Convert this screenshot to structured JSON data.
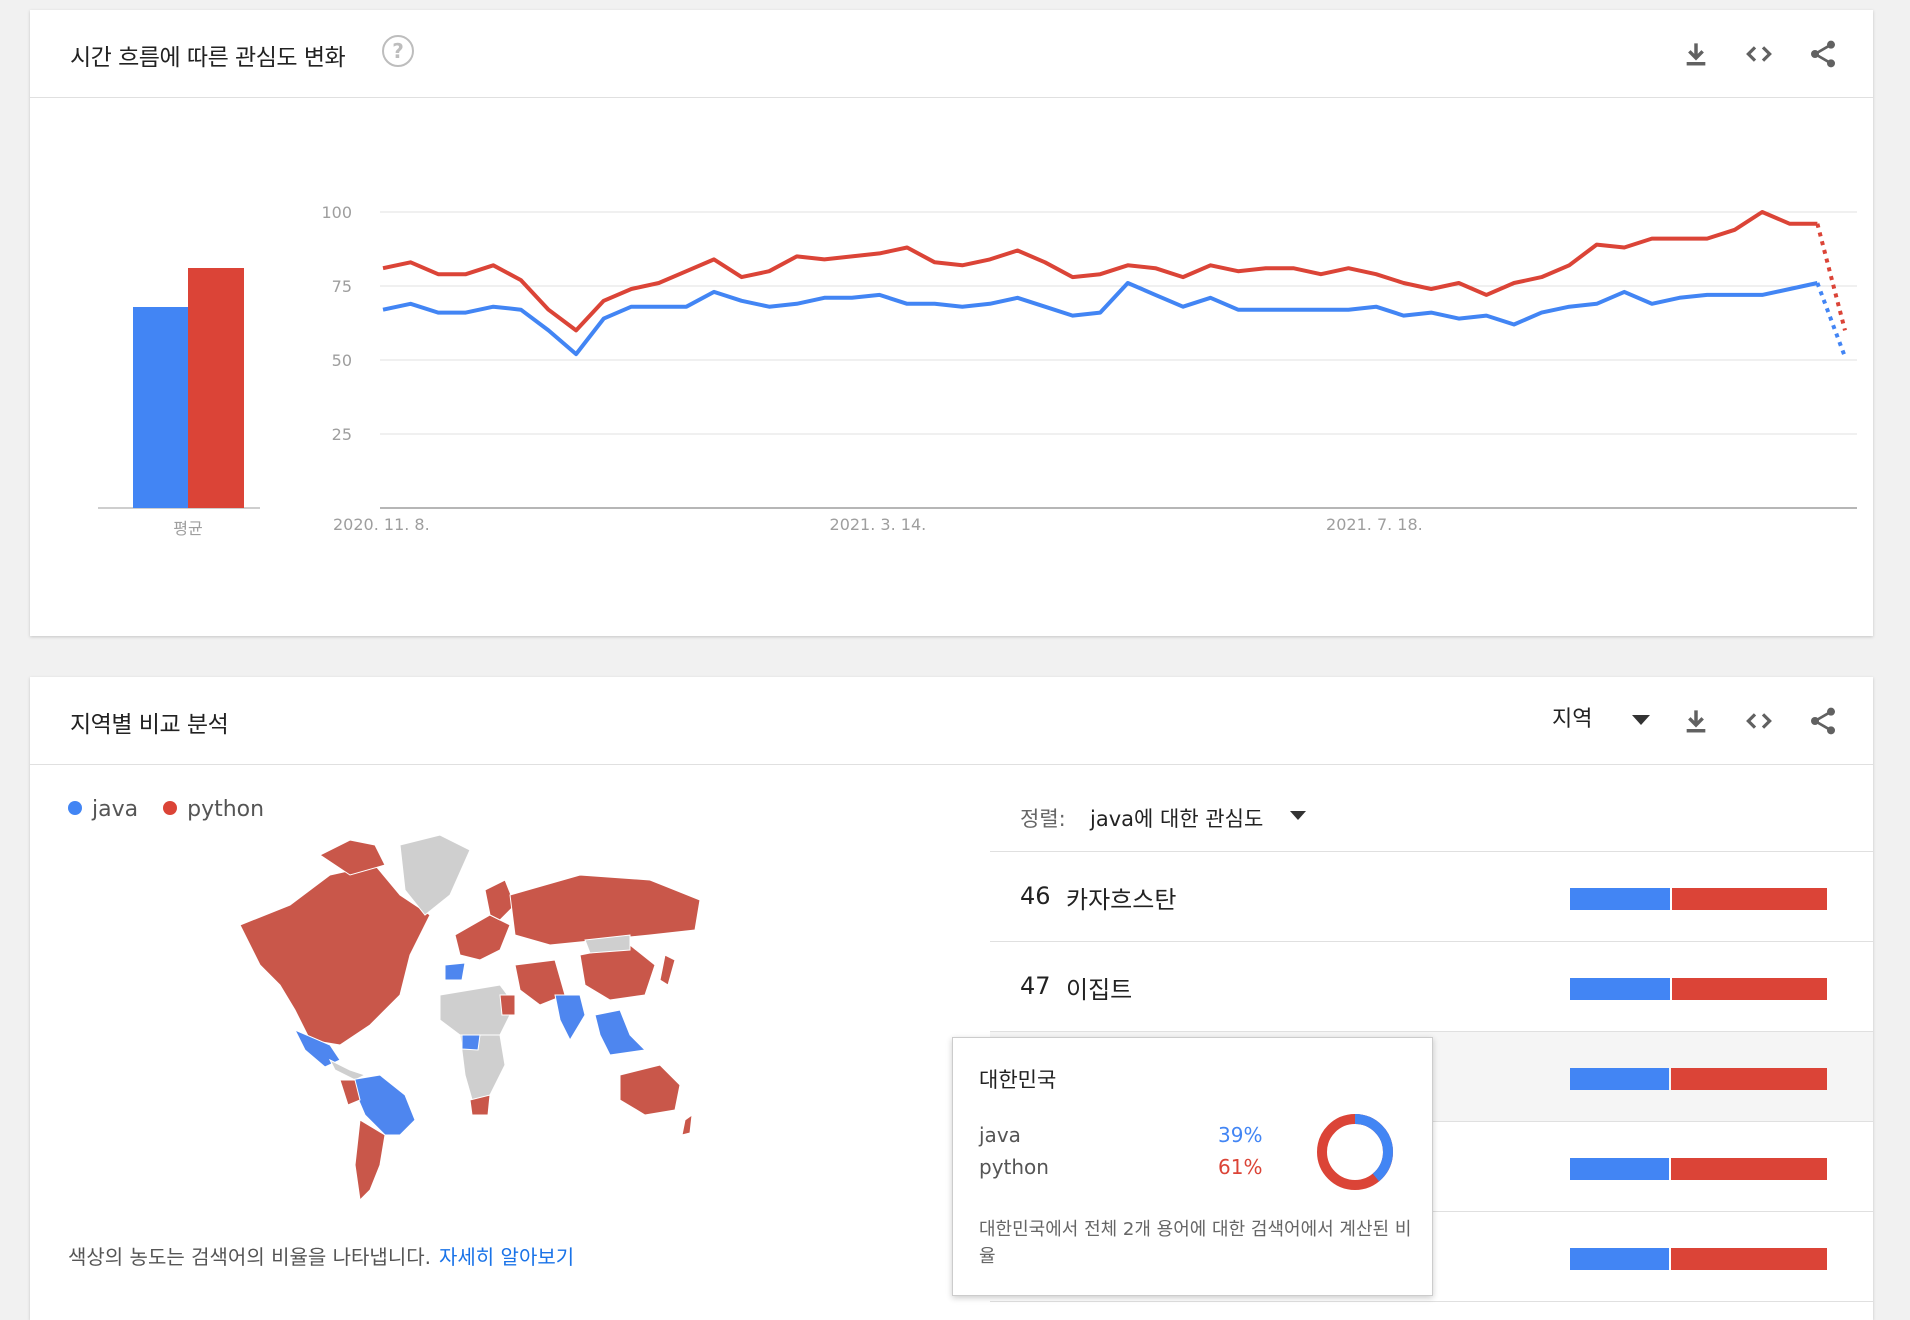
{
  "colors": {
    "java": "#4285f4",
    "python": "#db4437",
    "grid": "#e0e0e0",
    "axis_text": "#9e9e9e"
  },
  "section1": {
    "title": "시간 흐름에 따른 관심도 변화",
    "help_icon": "?",
    "avg_label": "평균"
  },
  "section2": {
    "title": "지역별 비교 분석",
    "region_select": "지역",
    "legend": [
      {
        "name": "java"
      },
      {
        "name": "python"
      }
    ],
    "footnote": "색상의 농도는 검색어의 비율을 나타냅니다.",
    "learn_more": "자세히 알아보기",
    "sort_label": "정렬:",
    "sort_value": "java에 대한 관심도",
    "rows": [
      {
        "rank": "46",
        "name": "카자흐스탄",
        "java": 0.39,
        "python": 0.61
      },
      {
        "rank": "47",
        "name": "이집트",
        "java": 0.39,
        "python": 0.61
      },
      {
        "rank": "",
        "name": "",
        "java": 0.385,
        "python": 0.615
      },
      {
        "rank": "",
        "name": "",
        "java": 0.385,
        "python": 0.615
      },
      {
        "rank": "",
        "name": "",
        "java": 0.385,
        "python": 0.615
      }
    ]
  },
  "tooltip": {
    "title": "대한민국",
    "items": [
      {
        "name": "java",
        "pct": "39%"
      },
      {
        "name": "python",
        "pct": "61%"
      }
    ],
    "donut": {
      "java": 0.39,
      "python": 0.61
    },
    "note": "대한민국에서 전체 2개 용어에 대한 검색어에서 계산된 비율"
  },
  "chart_data": [
    {
      "type": "bar",
      "categories": [
        "평균"
      ],
      "series": [
        {
          "name": "java",
          "values": [
            67
          ]
        },
        {
          "name": "python",
          "values": [
            80
          ]
        }
      ],
      "ylim": [
        0,
        100
      ]
    },
    {
      "type": "line",
      "ylim": [
        0,
        100
      ],
      "yticks": [
        25,
        50,
        75,
        100
      ],
      "xticklabels": [
        "2020. 11. 8.",
        "2021. 3. 14.",
        "2021. 7. 18."
      ],
      "xtick_positions": [
        0,
        18,
        36
      ],
      "grid": true,
      "partial_last_point": true,
      "series": [
        {
          "name": "java",
          "values": [
            67,
            69,
            66,
            66,
            68,
            67,
            60,
            52,
            64,
            68,
            68,
            68,
            73,
            70,
            68,
            69,
            71,
            71,
            72,
            69,
            69,
            68,
            69,
            71,
            68,
            65,
            66,
            76,
            72,
            68,
            71,
            67,
            67,
            67,
            67,
            67,
            68,
            65,
            66,
            64,
            65,
            62,
            66,
            68,
            69,
            73,
            69,
            71,
            72,
            72,
            72,
            74,
            76,
            51
          ]
        },
        {
          "name": "python",
          "values": [
            81,
            83,
            79,
            79,
            82,
            77,
            67,
            60,
            70,
            74,
            76,
            80,
            84,
            78,
            80,
            85,
            84,
            85,
            86,
            88,
            83,
            82,
            84,
            87,
            83,
            78,
            79,
            82,
            81,
            78,
            82,
            80,
            81,
            81,
            79,
            81,
            79,
            76,
            74,
            76,
            72,
            76,
            78,
            82,
            89,
            88,
            91,
            91,
            91,
            94,
            100,
            96,
            96,
            60
          ]
        }
      ]
    }
  ]
}
